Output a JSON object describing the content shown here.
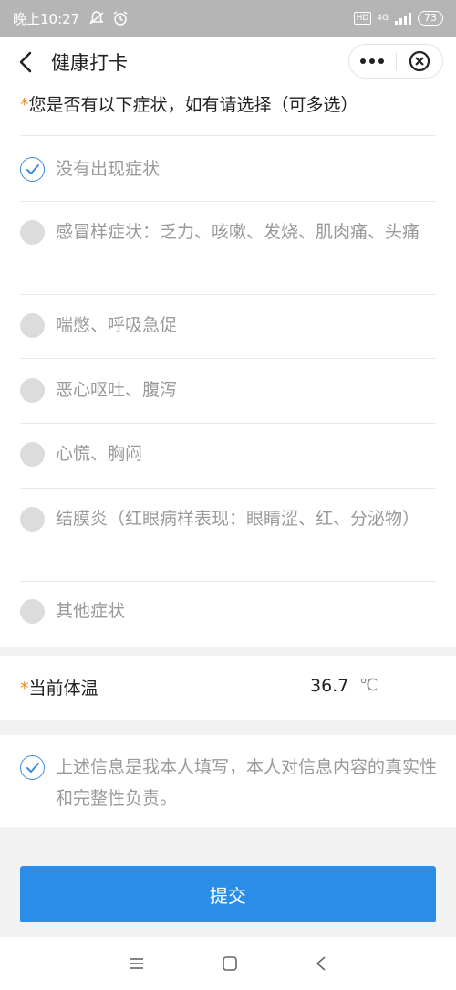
{
  "status_bar": {
    "time": "晚上10:27",
    "hd": "HD",
    "network": "4G",
    "battery": "73"
  },
  "nav": {
    "title": "健康打卡",
    "more_icon": "more-dots-icon",
    "close_icon": "close-circle-icon"
  },
  "question": {
    "required_mark": "*",
    "title": "您是否有以下症状，如有请选择（可多选）"
  },
  "options": [
    {
      "label": "没有出现症状",
      "checked": true
    },
    {
      "label": "感冒样症状：乏力、咳嗽、发烧、肌肉痛、头痛",
      "checked": false
    },
    {
      "label": "喘憋、呼吸急促",
      "checked": false
    },
    {
      "label": "恶心呕吐、腹泻",
      "checked": false
    },
    {
      "label": "心慌、胸闷",
      "checked": false
    },
    {
      "label": "结膜炎（红眼病样表现：眼睛涩、红、分泌物）",
      "checked": false
    },
    {
      "label": "其他症状",
      "checked": false
    }
  ],
  "temperature": {
    "required_mark": "*",
    "label": "当前体温",
    "value": "36.7",
    "unit": "℃"
  },
  "confirm": {
    "checked": true,
    "text": "上述信息是我本人填写，本人对信息内容的真实性和完整性负责。"
  },
  "submit_label": "提交",
  "colors": {
    "accent": "#2a8de8",
    "required": "#f08a24"
  }
}
